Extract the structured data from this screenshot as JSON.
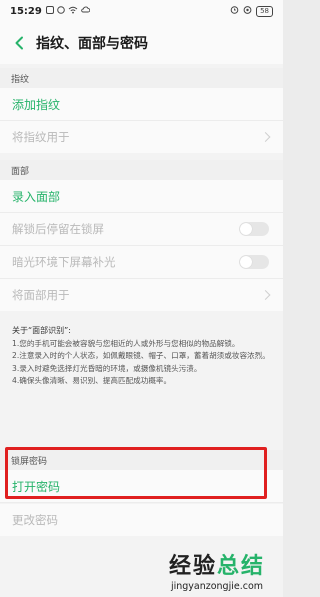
{
  "status_bar": {
    "time": "15:29",
    "battery": "58"
  },
  "header": {
    "title": "指纹、面部与密码"
  },
  "fingerprint": {
    "section": "指纹",
    "add_label": "添加指纹",
    "use_for_label": "将指纹用于"
  },
  "face": {
    "section": "面部",
    "enroll_label": "录入面部",
    "stay_locked_label": "解锁后停留在锁屏",
    "stay_locked_enabled": false,
    "low_light_label": "暗光环境下屏幕补光",
    "low_light_enabled": false,
    "use_for_label": "将面部用于"
  },
  "about": {
    "title": "关于“面部识别”:",
    "items": [
      "1.您的手机可能会被容貌与您相近的人或外形与您相似的物品解锁。",
      "2.注意录入时的个人状态，如佩戴眼镜、帽子、口罩，蓄着胡须或妆容浓烈。",
      "3.录入时避免选择灯光昏暗的环境，或摄像机镜头污渍。",
      "4.确保头像清晰、易识别、提高匹配成功概率。"
    ]
  },
  "lock_password": {
    "section": "锁屏密码",
    "open_label": "打开密码",
    "change_label": "更改密码"
  },
  "watermark": {
    "title_part1": "经验",
    "title_part2": "总结",
    "url": "jingyanzongjie.com"
  },
  "colors": {
    "accent_green": "#26b36a",
    "highlight_red": "#e02020"
  }
}
